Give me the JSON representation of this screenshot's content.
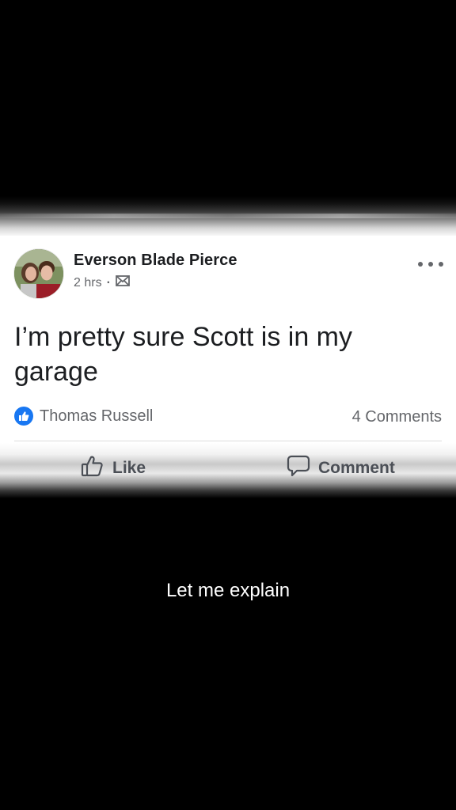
{
  "post": {
    "author": "Everson Blade Pierce",
    "time": "2 hrs",
    "separator": "·",
    "privacy_icon": "envelope-icon",
    "text": "I’m pretty sure Scott is in my garage",
    "reaction_names": "Thomas Russell",
    "reaction_icon": "thumbs-up-icon",
    "comments_count": "4 Comments"
  },
  "actions": {
    "like_label": "Like",
    "comment_label": "Comment"
  },
  "caption": "Let me explain",
  "colors": {
    "brand_blue": "#1877f2",
    "card": "#ffffff",
    "background": "#000000"
  }
}
